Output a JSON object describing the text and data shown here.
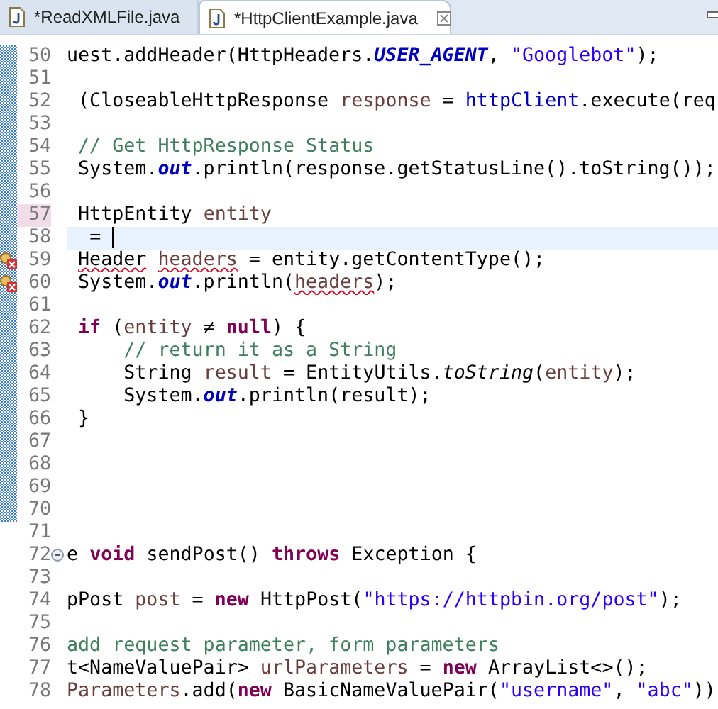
{
  "tabs": [
    {
      "label": "*ReadXMLFile.java",
      "selected": false
    },
    {
      "label": "*HttpClientExample.java",
      "selected": true
    }
  ],
  "lines": [
    {
      "number": "50",
      "changed": true,
      "current": false,
      "number_marked": false,
      "error": false,
      "collapsible": false,
      "tokens": [
        {
          "kind": "plain",
          "text": "uest.addHeader(HttpHeaders."
        },
        {
          "kind": "static-field",
          "text": "USER_AGENT"
        },
        {
          "kind": "plain",
          "text": ", "
        },
        {
          "kind": "string",
          "text": "\"Googlebot\""
        },
        {
          "kind": "plain",
          "text": ");"
        }
      ]
    },
    {
      "number": "51",
      "changed": true,
      "current": false,
      "number_marked": false,
      "error": false,
      "collapsible": false
    },
    {
      "number": "52",
      "changed": true,
      "current": false,
      "number_marked": false,
      "error": false,
      "collapsible": false,
      "tokens": [
        {
          "kind": "plain",
          "text": " (CloseableHttpResponse "
        },
        {
          "kind": "local",
          "text": "response"
        },
        {
          "kind": "plain",
          "text": " = "
        },
        {
          "kind": "field",
          "text": "httpClient"
        },
        {
          "kind": "plain",
          "text": ".execute(req"
        }
      ]
    },
    {
      "number": "53",
      "changed": true,
      "current": false,
      "number_marked": false,
      "error": false,
      "collapsible": false
    },
    {
      "number": "54",
      "changed": true,
      "current": false,
      "number_marked": false,
      "error": false,
      "collapsible": false,
      "tokens": [
        {
          "kind": "comment",
          "text": " // Get HttpResponse Status"
        }
      ]
    },
    {
      "number": "55",
      "changed": true,
      "current": false,
      "number_marked": false,
      "error": false,
      "collapsible": false,
      "tokens": [
        {
          "kind": "plain",
          "text": " System."
        },
        {
          "kind": "static-field",
          "text": "out"
        },
        {
          "kind": "plain",
          "text": ".println(response.getStatusLine().toString());"
        }
      ]
    },
    {
      "number": "56",
      "changed": true,
      "current": false,
      "number_marked": false,
      "error": false,
      "collapsible": false
    },
    {
      "number": "57",
      "changed": true,
      "current": false,
      "number_marked": true,
      "error": false,
      "collapsible": false,
      "tokens": [
        {
          "kind": "plain",
          "text": " HttpEntity "
        },
        {
          "kind": "local",
          "text": "entity"
        }
      ]
    },
    {
      "number": "58",
      "changed": true,
      "current": true,
      "number_marked": false,
      "error": false,
      "collapsible": false,
      "tokens": [
        {
          "kind": "plain",
          "text": "  = "
        }
      ]
    },
    {
      "number": "59",
      "changed": true,
      "current": false,
      "number_marked": false,
      "error": true,
      "collapsible": false,
      "tokens": [
        {
          "kind": "type-error",
          "text": " Header "
        },
        {
          "kind": "local-error",
          "text": "headers"
        },
        {
          "kind": "plain",
          "text": " = entity.getContentType();"
        }
      ]
    },
    {
      "number": "60",
      "changed": true,
      "current": false,
      "number_marked": false,
      "error": true,
      "collapsible": false,
      "tokens": [
        {
          "kind": "plain",
          "text": " System."
        },
        {
          "kind": "static-field",
          "text": "out"
        },
        {
          "kind": "plain",
          "text": ".println("
        },
        {
          "kind": "local-error",
          "text": "headers"
        },
        {
          "kind": "plain",
          "text": ");"
        }
      ]
    },
    {
      "number": "61",
      "changed": true,
      "current": false,
      "number_marked": false,
      "error": false,
      "collapsible": false
    },
    {
      "number": "62",
      "changed": true,
      "current": false,
      "number_marked": false,
      "error": false,
      "collapsible": false,
      "tokens": [
        {
          "kind": "keyword",
          "text": " if"
        },
        {
          "kind": "plain",
          "text": " ("
        },
        {
          "kind": "local",
          "text": "entity"
        },
        {
          "kind": "plain",
          "text": " ≠ "
        },
        {
          "kind": "keyword",
          "text": "null"
        },
        {
          "kind": "plain",
          "text": ") {"
        }
      ]
    },
    {
      "number": "63",
      "changed": true,
      "current": false,
      "number_marked": false,
      "error": false,
      "collapsible": false,
      "tokens": [
        {
          "kind": "comment",
          "text": "     // return it as a String"
        }
      ]
    },
    {
      "number": "64",
      "changed": true,
      "current": false,
      "number_marked": false,
      "error": false,
      "collapsible": false,
      "tokens": [
        {
          "kind": "plain",
          "text": "     String "
        },
        {
          "kind": "local",
          "text": "result"
        },
        {
          "kind": "plain",
          "text": " = EntityUtils."
        },
        {
          "kind": "static-method",
          "text": "toString"
        },
        {
          "kind": "plain",
          "text": "("
        },
        {
          "kind": "local",
          "text": "entity"
        },
        {
          "kind": "plain",
          "text": ");"
        }
      ]
    },
    {
      "number": "65",
      "changed": true,
      "current": false,
      "number_marked": false,
      "error": false,
      "collapsible": false,
      "tokens": [
        {
          "kind": "plain",
          "text": "     System."
        },
        {
          "kind": "static-field",
          "text": "out"
        },
        {
          "kind": "plain",
          "text": ".println(result);"
        }
      ]
    },
    {
      "number": "66",
      "changed": true,
      "current": false,
      "number_marked": false,
      "error": false,
      "collapsible": false,
      "tokens": [
        {
          "kind": "plain",
          "text": " }"
        }
      ]
    },
    {
      "number": "67",
      "changed": true,
      "current": false,
      "number_marked": false,
      "error": false,
      "collapsible": false
    },
    {
      "number": "68",
      "changed": true,
      "current": false,
      "number_marked": false,
      "error": false,
      "collapsible": false
    },
    {
      "number": "69",
      "changed": true,
      "current": false,
      "number_marked": false,
      "error": false,
      "collapsible": false
    },
    {
      "number": "70",
      "changed": true,
      "current": false,
      "number_marked": false,
      "error": false,
      "collapsible": false
    },
    {
      "number": "71",
      "changed": false,
      "current": false,
      "number_marked": false,
      "error": false,
      "collapsible": false
    },
    {
      "number": "72",
      "changed": false,
      "current": false,
      "number_marked": false,
      "error": false,
      "collapsible": true,
      "tokens": [
        {
          "kind": "plain",
          "text": "e "
        },
        {
          "kind": "keyword",
          "text": "void"
        },
        {
          "kind": "plain",
          "text": " sendPost() "
        },
        {
          "kind": "keyword",
          "text": "throws"
        },
        {
          "kind": "plain",
          "text": " Exception {"
        }
      ]
    },
    {
      "number": "73",
      "changed": false,
      "current": false,
      "number_marked": false,
      "error": false,
      "collapsible": false
    },
    {
      "number": "74",
      "changed": false,
      "current": false,
      "number_marked": false,
      "error": false,
      "collapsible": false,
      "tokens": [
        {
          "kind": "plain",
          "text": "pPost "
        },
        {
          "kind": "local",
          "text": "post"
        },
        {
          "kind": "plain",
          "text": " = "
        },
        {
          "kind": "keyword",
          "text": "new"
        },
        {
          "kind": "plain",
          "text": " HttpPost("
        },
        {
          "kind": "string",
          "text": "\"https://httpbin.org/post\""
        },
        {
          "kind": "plain",
          "text": ");"
        }
      ]
    },
    {
      "number": "75",
      "changed": false,
      "current": false,
      "number_marked": false,
      "error": false,
      "collapsible": false
    },
    {
      "number": "76",
      "changed": false,
      "current": false,
      "number_marked": false,
      "error": false,
      "collapsible": false,
      "tokens": [
        {
          "kind": "comment",
          "text": "add request parameter, form parameters"
        }
      ]
    },
    {
      "number": "77",
      "changed": false,
      "current": false,
      "number_marked": false,
      "error": false,
      "collapsible": false,
      "tokens": [
        {
          "kind": "plain",
          "text": "t<NameValuePair> "
        },
        {
          "kind": "local",
          "text": "urlParameters"
        },
        {
          "kind": "plain",
          "text": " = "
        },
        {
          "kind": "keyword",
          "text": "new"
        },
        {
          "kind": "plain",
          "text": " ArrayList<>();"
        }
      ]
    },
    {
      "number": "78",
      "changed": false,
      "current": false,
      "number_marked": false,
      "error": false,
      "collapsible": false,
      "tokens": [
        {
          "kind": "local",
          "text": "Parameters"
        },
        {
          "kind": "plain",
          "text": ".add("
        },
        {
          "kind": "keyword",
          "text": "new"
        },
        {
          "kind": "plain",
          "text": " BasicNameValuePair("
        },
        {
          "kind": "string",
          "text": "\"username\""
        },
        {
          "kind": "plain",
          "text": ", "
        },
        {
          "kind": "string",
          "text": "\"abc\""
        },
        {
          "kind": "plain",
          "text": "))"
        }
      ]
    }
  ]
}
